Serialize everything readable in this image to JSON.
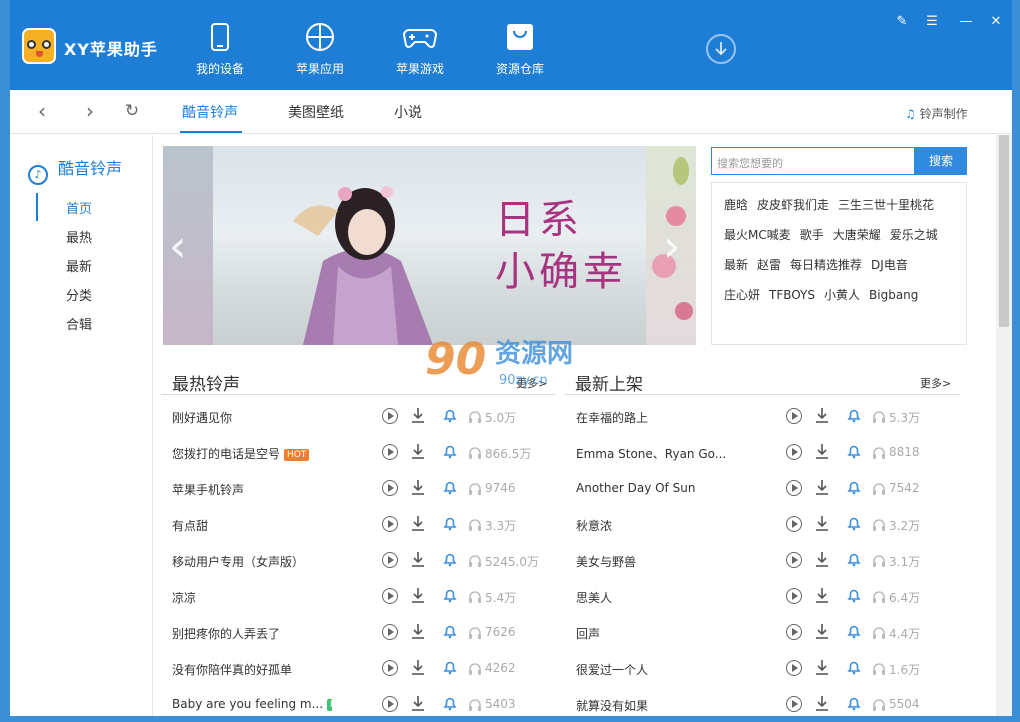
{
  "app": {
    "name": "XY苹果助手"
  },
  "nav": [
    {
      "label": "我的设备",
      "icon": "tablet-icon"
    },
    {
      "label": "苹果应用",
      "icon": "apps-icon"
    },
    {
      "label": "苹果游戏",
      "icon": "gamepad-icon"
    },
    {
      "label": "资源仓库",
      "icon": "bag-icon"
    }
  ],
  "tabs": [
    "酷音铃声",
    "美图壁纸",
    "小说"
  ],
  "ringtone_maker": "铃声制作",
  "sidebar": {
    "title": "酷音铃声",
    "items": [
      "首页",
      "最热",
      "最新",
      "分类",
      "合辑"
    ]
  },
  "banner": {
    "line1": "日系",
    "line2": "小确幸"
  },
  "search": {
    "placeholder": "搜索您想要的",
    "button": "搜索"
  },
  "hot_words": [
    [
      "鹿晗",
      "皮皮虾我们走",
      "三生三世十里桃花"
    ],
    [
      "最火MC喊麦",
      "歌手",
      "大唐荣耀",
      "爱乐之城"
    ],
    [
      "最新",
      "赵雷",
      "每日精选推荐",
      "DJ电音"
    ],
    [
      "庄心妍",
      "TFBOYS",
      "小黄人",
      "Bigbang"
    ]
  ],
  "sections": {
    "hot": {
      "title": "最热铃声",
      "more": "更多>"
    },
    "new": {
      "title": "最新上架",
      "more": "更多>"
    }
  },
  "hot_list": [
    {
      "name": "刚好遇见你",
      "count": "5.0万",
      "badge": ""
    },
    {
      "name": "您拨打的电话是空号",
      "count": "866.5万",
      "badge": "HOT"
    },
    {
      "name": "苹果手机铃声",
      "count": "9746",
      "badge": ""
    },
    {
      "name": "有点甜",
      "count": "3.3万",
      "badge": ""
    },
    {
      "name": "移动用户专用（女声版）",
      "count": "5245.0万",
      "badge": ""
    },
    {
      "name": "凉凉",
      "count": "5.4万",
      "badge": ""
    },
    {
      "name": "别把疼你的人弄丢了",
      "count": "7626",
      "badge": ""
    },
    {
      "name": "没有你陪伴真的好孤单",
      "count": "4262",
      "badge": ""
    },
    {
      "name": "Baby are you feeling m...",
      "count": "5403",
      "badge": "NEW"
    }
  ],
  "new_list": [
    {
      "name": "在幸福的路上",
      "count": "5.3万"
    },
    {
      "name": "Emma Stone、Ryan Go...",
      "count": "8818"
    },
    {
      "name": "Another Day Of Sun",
      "count": "7542"
    },
    {
      "name": "秋意浓",
      "count": "3.2万"
    },
    {
      "name": "美女与野兽",
      "count": "3.1万"
    },
    {
      "name": "思美人",
      "count": "6.4万"
    },
    {
      "name": "回声",
      "count": "4.4万"
    },
    {
      "name": "很爱过一个人",
      "count": "1.6万"
    },
    {
      "name": "就算没有如果",
      "count": "5504"
    }
  ],
  "watermark": {
    "brand": "资源网",
    "site": "90zy.cn"
  },
  "colors": {
    "primary": "#1e7ed6",
    "hot_badge": "#f07d2c",
    "new_badge": "#3fc46f",
    "banner_text": "#a8337e"
  }
}
